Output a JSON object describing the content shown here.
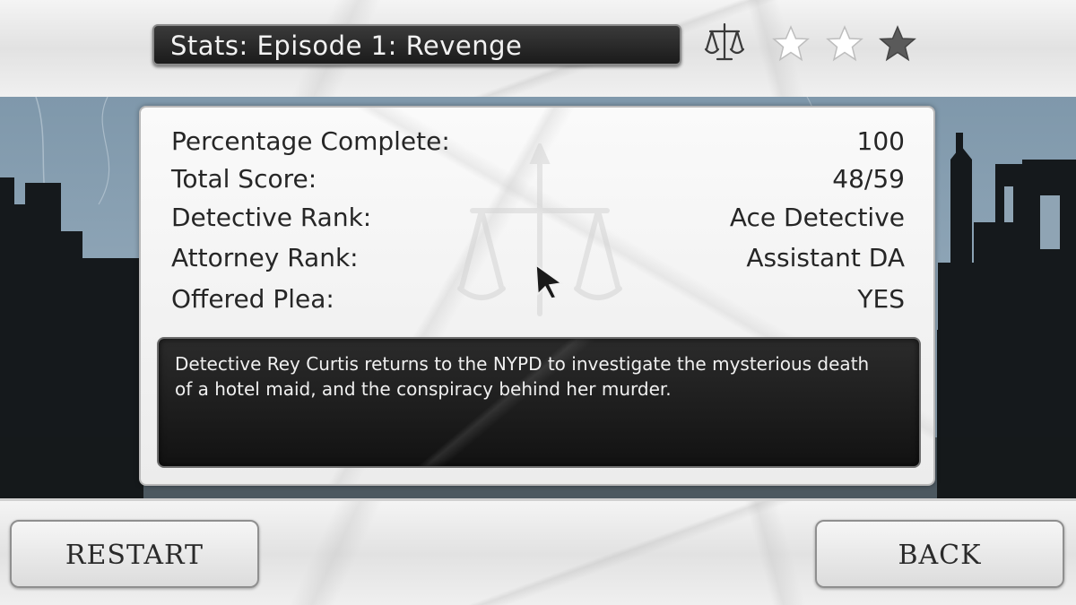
{
  "header": {
    "title": "Stats:  Episode 1: Revenge",
    "stars": {
      "earned": 2,
      "total": 3
    },
    "colors": {
      "star_filled": "#ffffff",
      "star_empty": "#5a5a5a"
    },
    "icon": "scales-of-justice-icon"
  },
  "stats": [
    {
      "label": "Percentage Complete:",
      "value": "100"
    },
    {
      "label": "Total Score:",
      "value": "48/59"
    },
    {
      "label": "Detective Rank:",
      "value": "Ace Detective"
    },
    {
      "label": "Attorney Rank:",
      "value": "Assistant DA"
    },
    {
      "label": "Offered Plea:",
      "value": "YES"
    }
  ],
  "description": "Detective Rey Curtis returns to the NYPD to investigate the mysterious death of a hotel maid, and the conspiracy behind her murder.",
  "buttons": {
    "restart_label": "RESTART",
    "back_label": "BACK"
  }
}
